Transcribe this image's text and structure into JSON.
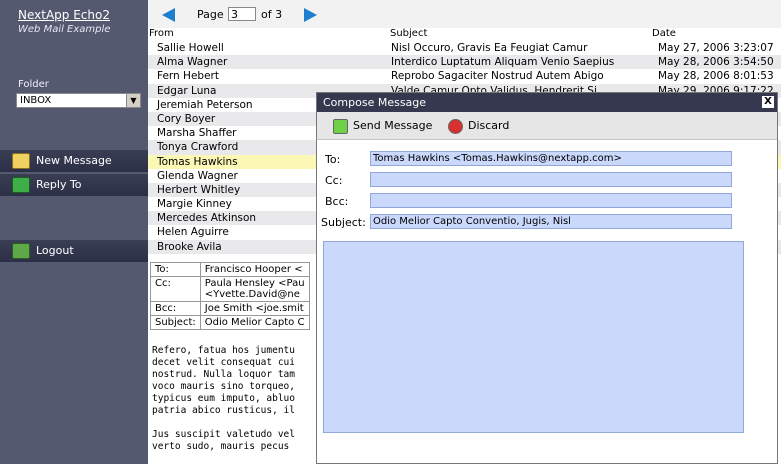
{
  "sidebar": {
    "app_title": "NextApp Echo2",
    "app_subtitle": "Web Mail Example",
    "folder_label": "Folder",
    "folder_value": "INBOX",
    "buttons": [
      "New Message",
      "Reply To",
      "Logout"
    ]
  },
  "pager": {
    "page_label": "Page",
    "page_value": "3",
    "of_label": "of 3"
  },
  "list": {
    "headers": {
      "from": "From",
      "subject": "Subject",
      "date": "Date"
    },
    "rows": [
      {
        "from": "Sallie Howell",
        "subject": "Nisl Occuro, Gravis Ea Feugiat Camur",
        "date": "May 27, 2006 3:23:07"
      },
      {
        "from": "Alma Wagner",
        "subject": "Interdico Luptatum Aliquam Venio Saepius",
        "date": "May 28, 2006 3:54:50"
      },
      {
        "from": "Fern Hebert",
        "subject": "Reprobo Sagaciter Nostrud Autem Abigo",
        "date": "May 28, 2006 8:01:53"
      },
      {
        "from": "Edgar Luna",
        "subject": "Valde Camur Opto Validus, Hendrerit Si",
        "date": "May 29, 2006 9:17:22"
      },
      {
        "from": "Jeremiah Peterson",
        "subject": "",
        "date": ""
      },
      {
        "from": "Cory Boyer",
        "subject": "",
        "date": ""
      },
      {
        "from": "Marsha Shaffer",
        "subject": "",
        "date": ""
      },
      {
        "from": "Tonya Crawford",
        "subject": "",
        "date": ""
      },
      {
        "from": "Tomas Hawkins",
        "subject": "",
        "date": ""
      },
      {
        "from": "Glenda Wagner",
        "subject": "",
        "date": ""
      },
      {
        "from": "Herbert Whitley",
        "subject": "",
        "date": ""
      },
      {
        "from": "Margie Kinney",
        "subject": "",
        "date": ""
      },
      {
        "from": "Mercedes Atkinson",
        "subject": "",
        "date": ""
      },
      {
        "from": "Helen Aguirre",
        "subject": "",
        "date": ""
      },
      {
        "from": "Brooke Avila",
        "subject": "",
        "date": ""
      }
    ]
  },
  "detail": {
    "to_label": "To:",
    "to_value": "Francisco Hooper <",
    "cc_label": "Cc:",
    "cc_value_1": "Paula Hensley <Pau",
    "cc_value_2": "<Yvette.David@ne",
    "bcc_label": "Bcc:",
    "bcc_value": "Joe Smith <joe.smit",
    "subject_label": "Subject:",
    "subject_value": "Odio Melior Capto C",
    "body": "Refero, fatua hos jumentu\ndecet velit consequat cui\nnostrud. Nulla loquor tam\nvoco mauris sino torqueo,\ntypicus eum imputo, abluo\npatria abico rusticus, il\n\nJus suscipit valetudo vel\nverto sudo, mauris pecus"
  },
  "compose": {
    "title": "Compose Message",
    "close": "X",
    "send_label": "Send Message",
    "discard_label": "Discard",
    "to_label": "To:",
    "to_value": "Tomas Hawkins <Tomas.Hawkins@nextapp.com>",
    "cc_label": "Cc:",
    "cc_value": "",
    "bcc_label": "Bcc:",
    "bcc_value": "",
    "subject_label": "Subject:",
    "subject_value": "Odio Melior Capto Conventio, Jugis, Nisl",
    "body_value": ""
  },
  "colors": {
    "sidebar": "#55596f",
    "selected_row": "#fbf7b4",
    "field": "#c9d8fb",
    "titlebar": "#35384f",
    "arrow": "#1f7fcf"
  }
}
